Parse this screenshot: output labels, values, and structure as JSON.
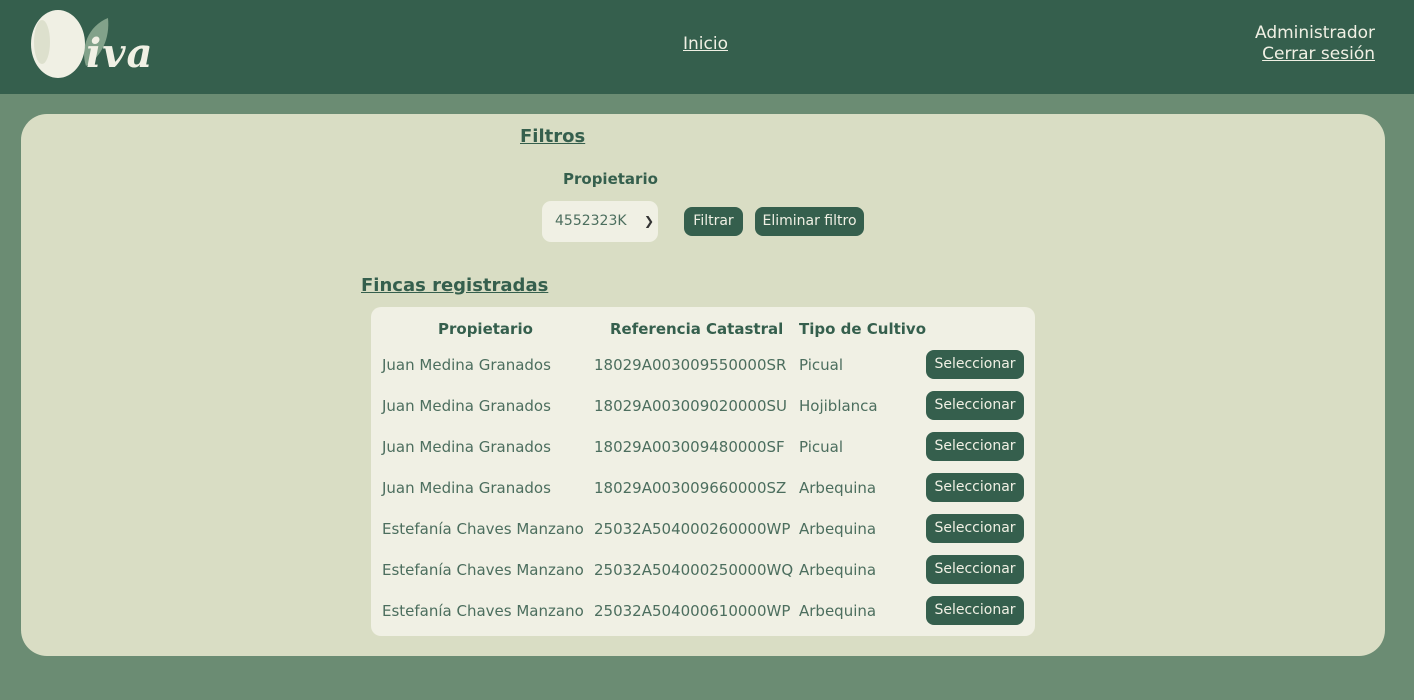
{
  "header": {
    "logo_text": "iva",
    "nav_home": "Inicio",
    "user_role": "Administrador",
    "logout": "Cerrar sesión"
  },
  "filters": {
    "title": "Filtros",
    "owner_label": "Propietario",
    "owner_selected": "4552323K",
    "filter_button": "Filtrar",
    "clear_button": "Eliminar filtro"
  },
  "farms": {
    "title": "Fincas registradas",
    "columns": [
      "Propietario",
      "Referencia Catastral",
      "Tipo de Cultivo"
    ],
    "select_label": "Seleccionar",
    "rows": [
      {
        "owner": "Juan Medina Granados",
        "ref": "18029A003009550000SR",
        "crop": "Picual"
      },
      {
        "owner": "Juan Medina Granados",
        "ref": "18029A003009020000SU",
        "crop": "Hojiblanca"
      },
      {
        "owner": "Juan Medina Granados",
        "ref": "18029A003009480000SF",
        "crop": "Picual"
      },
      {
        "owner": "Juan Medina Granados",
        "ref": "18029A003009660000SZ",
        "crop": "Arbequina"
      },
      {
        "owner": "Estefanía Chaves Manzano",
        "ref": "25032A504000260000WP",
        "crop": "Arbequina"
      },
      {
        "owner": "Estefanía Chaves Manzano",
        "ref": "25032A504000250000WQ",
        "crop": "Arbequina"
      },
      {
        "owner": "Estefanía Chaves Manzano",
        "ref": "25032A504000610000WP",
        "crop": "Arbequina"
      }
    ]
  },
  "colors": {
    "header_bg": "#355f4d",
    "page_bg": "#6b8c73",
    "panel_bg": "#d9ddc4",
    "card_bg": "#f0f0e4",
    "accent": "#355f4d"
  }
}
